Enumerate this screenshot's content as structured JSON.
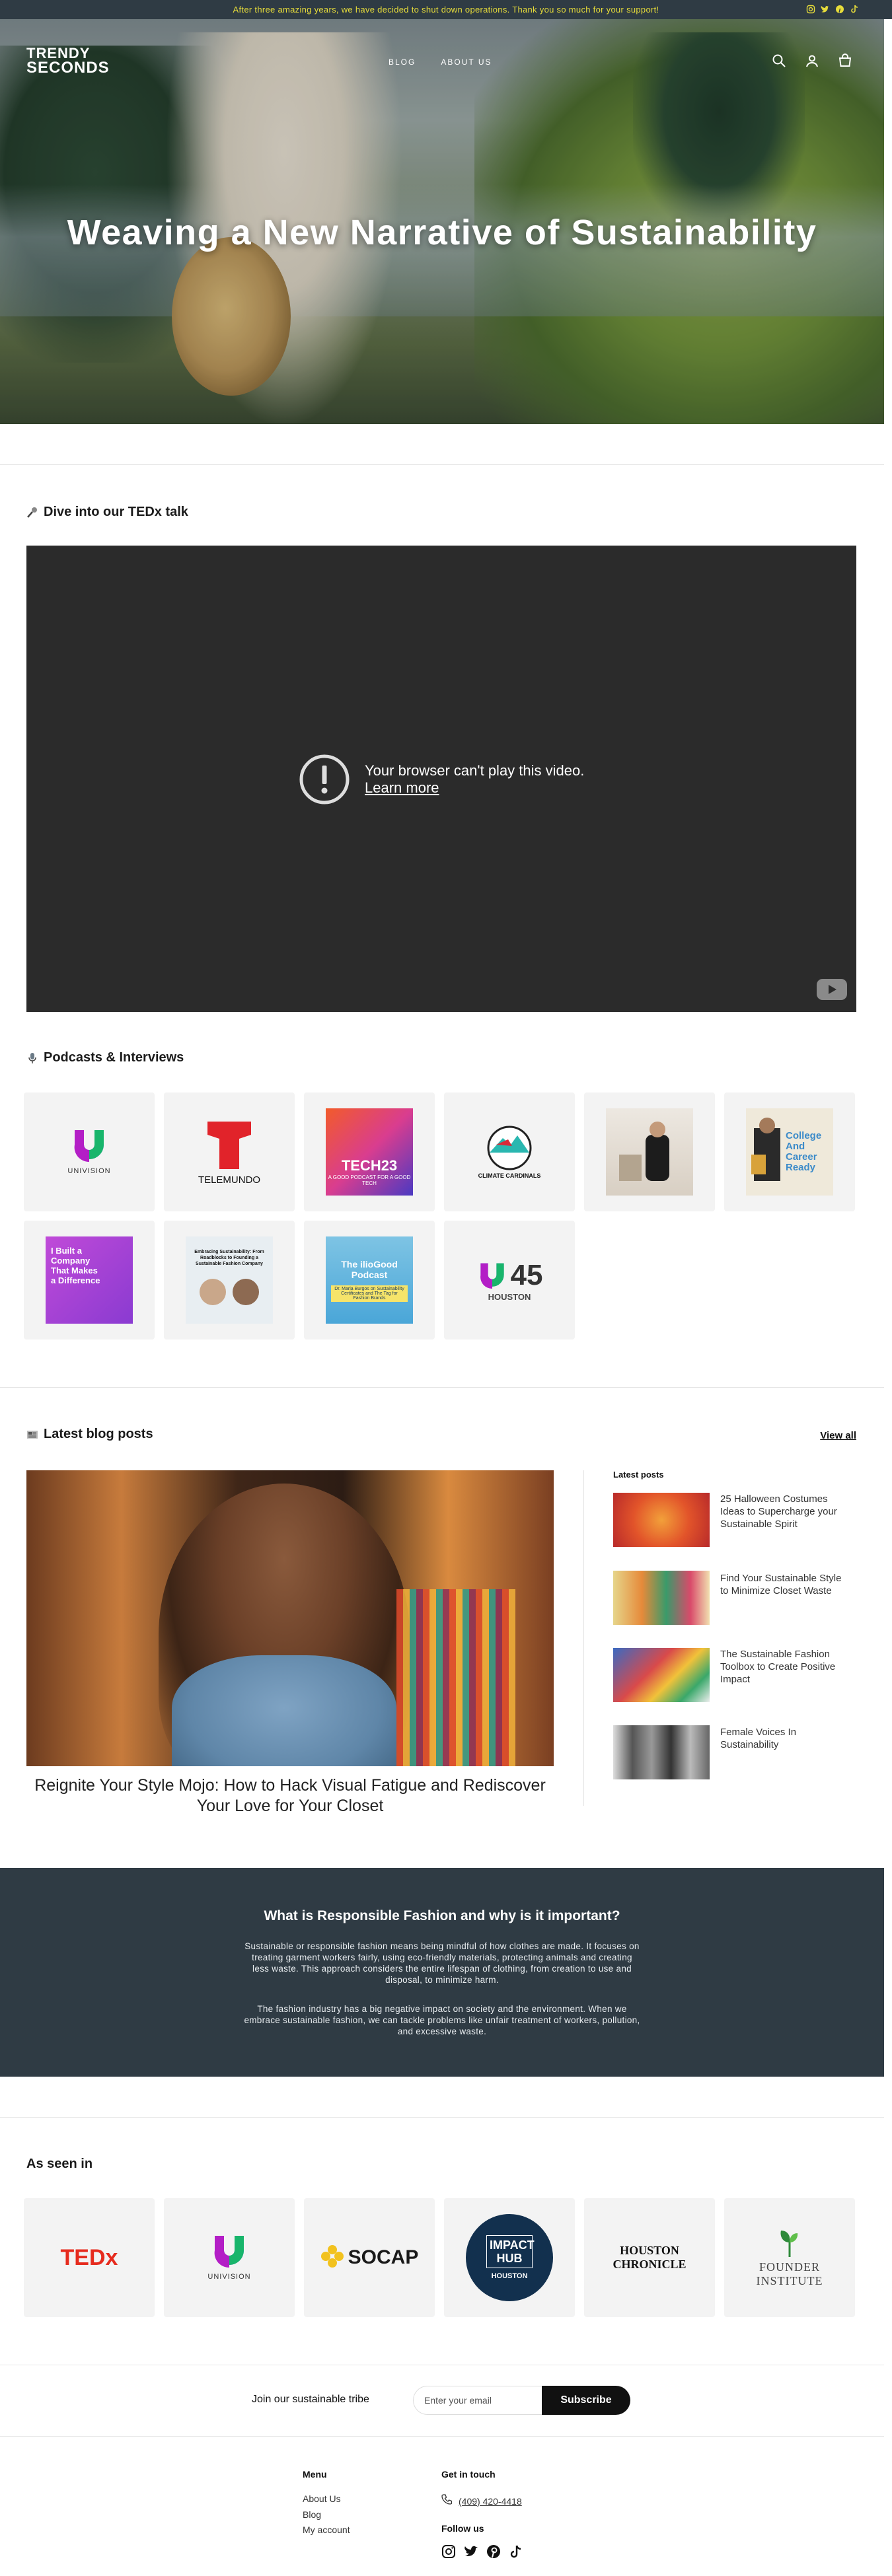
{
  "announcement": {
    "text": "After three amazing years, we have decided to shut down operations. Thank you so much for your support!",
    "social_icons": [
      "instagram-icon",
      "twitter-icon",
      "pinterest-icon",
      "tiktok-icon"
    ]
  },
  "header": {
    "logo_line1": "TRENDY",
    "logo_line2": "SECONDS",
    "nav": [
      {
        "label": "BLOG"
      },
      {
        "label": "ABOUT US"
      }
    ],
    "icons": [
      "search-icon",
      "account-icon",
      "cart-icon"
    ]
  },
  "hero": {
    "title": "Weaving a New Narrative of Sustainability"
  },
  "tedx": {
    "heading": "Dive into our TEDx talk",
    "video_error": "Your browser can't play this video.",
    "video_learn_more": "Learn more"
  },
  "podcasts": {
    "heading": "Podcasts & Interviews",
    "tiles": [
      {
        "label": "UNIVISION"
      },
      {
        "label": "TELEMUNDO"
      },
      {
        "label": "TECH23",
        "sub": "A GOOD PODCAST FOR A GOOD TECH"
      },
      {
        "label": "CLIMATE CARDINALS"
      },
      {
        "label": ""
      },
      {
        "label": "College And Career Ready"
      },
      {
        "label": "I Built a Company That Makes a Difference"
      },
      {
        "label": "Embracing Sustainability: From Roadblocks to Founding a Sustainable Fashion Company"
      },
      {
        "label": "The ilioGood Podcast",
        "sub": "Dr. Maria Burgos on Sustainability Certificates and The Tag for Fashion Brands"
      },
      {
        "label": "45",
        "sub": "HOUSTON"
      }
    ]
  },
  "blog": {
    "heading": "Latest blog posts",
    "view_all": "View all",
    "feature_title": "Reignite Your Style Mojo: How to Hack Visual Fatigue and Rediscover Your Love for Your Closet",
    "latest_label": "Latest posts",
    "posts": [
      {
        "title": "25 Halloween Costumes Ideas to Supercharge your Sustainable Spirit"
      },
      {
        "title": "Find Your Sustainable Style to Minimize Closet Waste"
      },
      {
        "title": "The Sustainable Fashion Toolbox to Create Positive Impact"
      },
      {
        "title": "Female Voices In Sustainability"
      }
    ]
  },
  "responsible": {
    "heading": "What is Responsible Fashion and why is it important?",
    "p1": "Sustainable or responsible fashion means being mindful of how clothes are made. It focuses on treating garment workers fairly, using eco-friendly materials, protecting animals and creating less waste. This approach considers the entire lifespan of clothing, from creation to use and disposal, to minimize harm.",
    "p2": "The fashion industry has a big negative impact on society and the environment. When we embrace sustainable fashion, we can tackle problems like unfair treatment of workers, pollution, and excessive waste."
  },
  "seen_in": {
    "heading": "As seen in",
    "tiles": [
      {
        "label": "TEDx"
      },
      {
        "label": "UNIVISION"
      },
      {
        "label": "SOCAP"
      },
      {
        "label": "IMPACT HUB",
        "sub": "HOUSTON"
      },
      {
        "label": "HOUSTON",
        "sub": "CHRONICLE"
      },
      {
        "label": "FOUNDER",
        "sub": "INSTITUTE"
      }
    ]
  },
  "newsletter": {
    "label": "Join our sustainable tribe",
    "placeholder": "Enter your email",
    "button": "Subscribe"
  },
  "footer": {
    "menu_heading": "Menu",
    "menu": [
      {
        "label": "About Us"
      },
      {
        "label": "Blog"
      },
      {
        "label": "My account"
      }
    ],
    "contact_heading": "Get in touch",
    "phone": "(409) 420-4418",
    "follow_heading": "Follow us",
    "social_icons": [
      "instagram-icon",
      "twitter-icon",
      "pinterest-icon",
      "tiktok-icon"
    ]
  },
  "colors": {
    "announcement_bg": "#2f3b44",
    "announcement_text": "#e7dc3a",
    "dark_section_bg": "#2f3b44",
    "button_bg": "#111111"
  }
}
